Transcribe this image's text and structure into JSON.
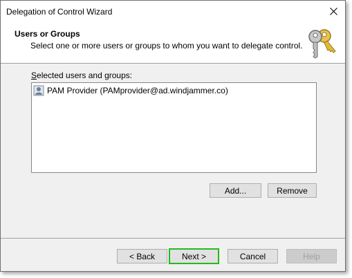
{
  "window": {
    "title": "Delegation of Control Wizard",
    "close_icon": "close-icon"
  },
  "header": {
    "title": "Users or Groups",
    "subtitle": "Select one or more users or groups to whom you want to delegate control.",
    "icon": "keys-icon"
  },
  "selection": {
    "label": "Selected users and groups:",
    "items": [
      {
        "label": "PAM Provider (PAMprovider@ad.windjammer.co)",
        "icon": "user-icon"
      }
    ],
    "add_label": "Add...",
    "remove_label": "Remove"
  },
  "footer": {
    "back_prefix": "< ",
    "back_label": "Back",
    "next_label": "Next",
    "next_suffix": " >",
    "cancel_label": "Cancel",
    "help_label": "Help"
  },
  "colors": {
    "focus_highlight": "#1fbb1f",
    "dialog_bg": "#f0f0f0"
  }
}
